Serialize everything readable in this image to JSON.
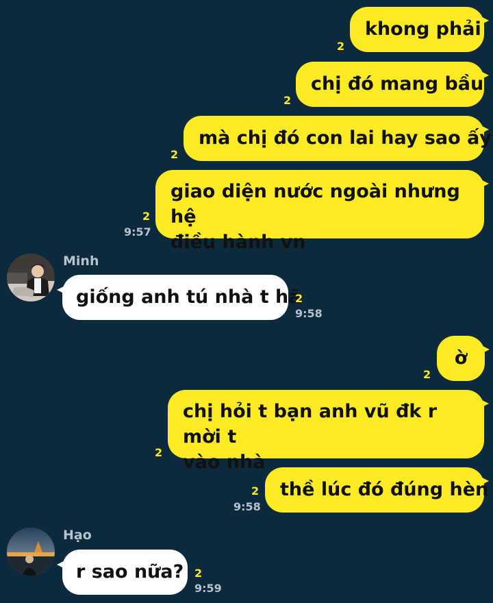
{
  "conversation": {
    "messages": [
      {
        "text": "khong phải",
        "unread": "2",
        "time": ""
      },
      {
        "text": "chị đó mang bầu",
        "unread": "2",
        "time": ""
      },
      {
        "text": "mà chị đó con lai hay sao ấy",
        "unread": "2",
        "time": ""
      },
      {
        "line1": "giao diện nước ngoài nhưng hệ",
        "line2": "điều hành vn",
        "unread": "2",
        "time": "9:57"
      },
      {
        "sender": "Minh",
        "text": "giống anh tú nhà t hã",
        "unread": "2",
        "time": "9:58"
      },
      {
        "text": "ờ",
        "unread": "2",
        "time": ""
      },
      {
        "line1": "chị hỏi t bạn anh vũ đk r mời t",
        "line2": "vào nhà",
        "unread": "2",
        "time": ""
      },
      {
        "text": "thề lúc đó đúng hèn",
        "unread": "2",
        "time": "9:58"
      },
      {
        "sender": "Hạo",
        "text": "r sao nữa?",
        "unread": "2",
        "time": "9:59"
      }
    ]
  },
  "colors": {
    "background": "#0d2a3c",
    "outgoing_bubble": "#fcea24",
    "incoming_bubble": "#ffffff",
    "unread_count": "#fcea24",
    "timestamp": "#b6c3cc"
  }
}
